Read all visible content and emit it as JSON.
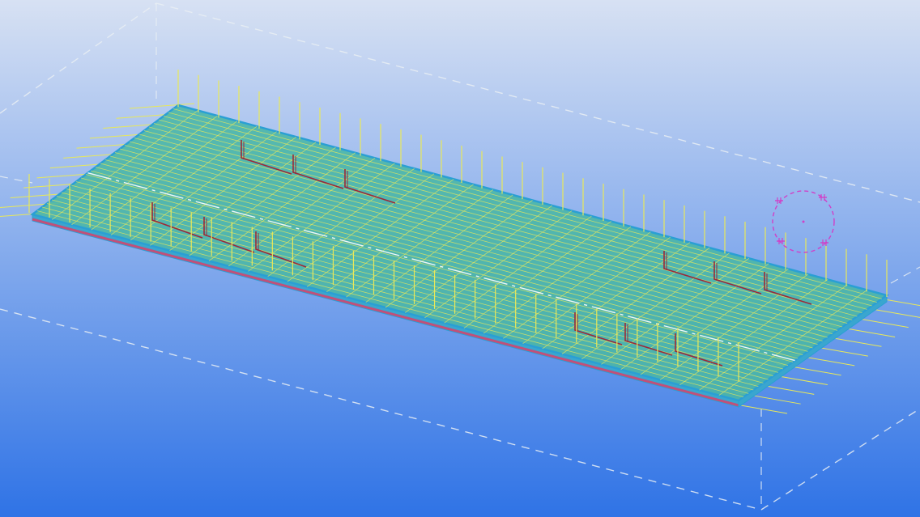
{
  "viewport": {
    "background_top": "#d7e1f3",
    "background_bottom": "#2f73e6",
    "view_box_color": "#e9eef3",
    "slab_fill": "#49b6a6",
    "slab_edge": "#2a9fd4",
    "slab_side": "#3aa6cf",
    "bottom_edge_color": "#c0507a",
    "rebar_color": "#e8e85a",
    "stirrup_color": "#c8c83a",
    "hook_bar_color": "#9a2a3a",
    "center_line_color": "#ffffff",
    "cursor_color": "#d040c8"
  },
  "model": {
    "type": "3d-rebar-slab",
    "longitudinal_bar_count": 30,
    "transverse_bar_count": 36,
    "stirrup_rows": 2,
    "hook_groups": 4
  }
}
